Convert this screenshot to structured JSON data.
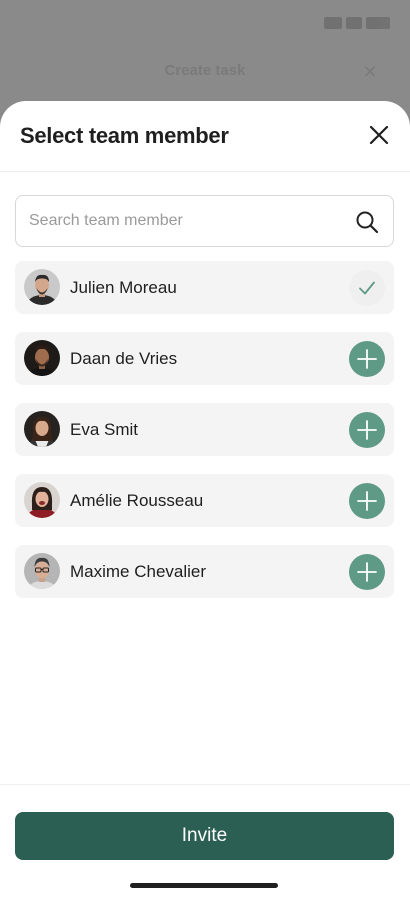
{
  "background": {
    "title": "Create task"
  },
  "sheet": {
    "title": "Select team member",
    "close_icon": "close-icon"
  },
  "search": {
    "placeholder": "Search team member",
    "value": "",
    "icon": "search-icon"
  },
  "members": [
    {
      "name": "Julien Moreau",
      "selected": true,
      "action_icon": "check-icon"
    },
    {
      "name": "Daan de Vries",
      "selected": false,
      "action_icon": "plus-icon"
    },
    {
      "name": "Eva Smit",
      "selected": false,
      "action_icon": "plus-icon"
    },
    {
      "name": "Amélie Rousseau",
      "selected": false,
      "action_icon": "plus-icon"
    },
    {
      "name": "Maxime Chevalier",
      "selected": false,
      "action_icon": "plus-icon"
    }
  ],
  "footer": {
    "invite_label": "Invite"
  },
  "colors": {
    "primary": "#2c5f53",
    "add_button": "#5f9a87",
    "row_background": "#f4f4f4",
    "check": "#5f9a87"
  }
}
